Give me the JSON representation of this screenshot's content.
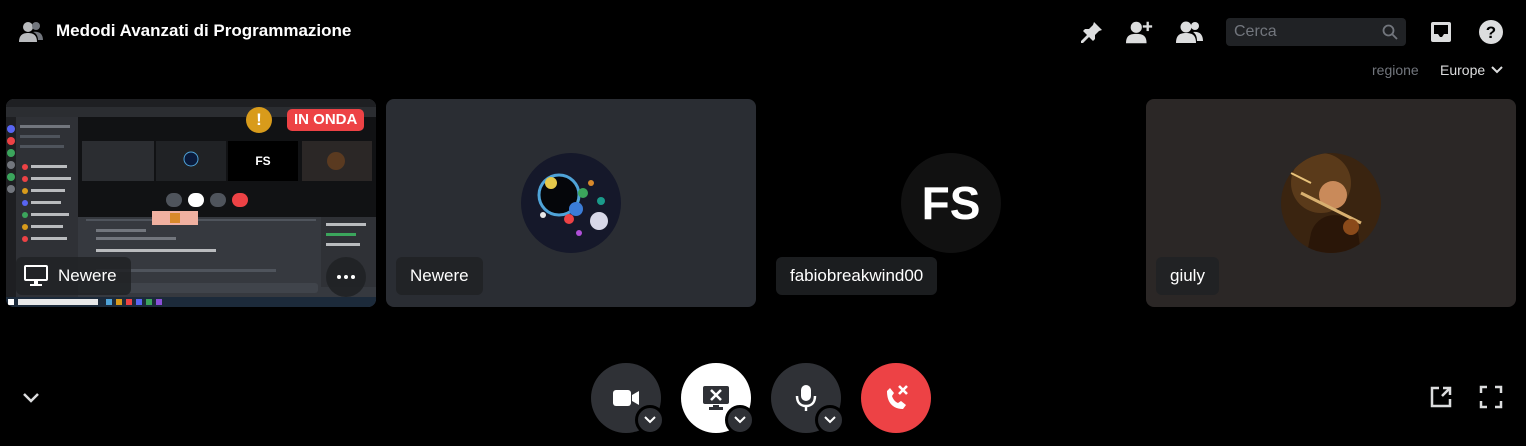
{
  "header": {
    "channel_icon": "voice-channel-users-icon",
    "title": "Medodi Avanzati di Programmazione",
    "toolbar_icons": [
      "pin-icon",
      "add-friend-icon",
      "members-icon",
      "inbox-icon",
      "help-icon"
    ]
  },
  "search": {
    "placeholder": "Cerca",
    "icon": "search-icon"
  },
  "region": {
    "label": "regione",
    "value": "Europe"
  },
  "tiles": [
    {
      "name": "Newere",
      "type": "stream",
      "badge": "IN ONDA",
      "warning": "!",
      "icon": "screen-share-icon"
    },
    {
      "name": "Newere",
      "type": "user"
    },
    {
      "name": "fabiobreakwind00",
      "type": "user"
    },
    {
      "name": "giuly",
      "type": "user"
    }
  ],
  "controls": {
    "camera": "video-camera-icon",
    "screen": "stop-screen-share-icon",
    "mic": "microphone-icon",
    "disconnect": "disconnect-call-icon"
  },
  "colors": {
    "background": "#000000",
    "live_red": "#ed4245",
    "disconnect_red": "#ed4245",
    "warning_orange": "#d89b1b",
    "control_gray": "#2f3136"
  }
}
